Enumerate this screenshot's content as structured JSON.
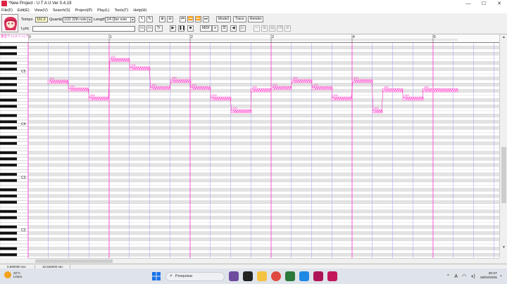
{
  "window": {
    "title": "*New Project - U T A U Ver 0.4.19",
    "controls": [
      "—",
      "☐",
      "✕"
    ]
  },
  "menu": [
    "File(F)",
    "Edit(E)",
    "View(V)",
    "Search(S)",
    "Project(P)",
    "Play(L)",
    "Tools(T)",
    "Help(H)"
  ],
  "toolbar": {
    "tempo_label": "Tempo",
    "tempo_value": "101.0",
    "quantize_label": "Quantize",
    "quantize_value": "1/32 32th note",
    "length_label": "Length",
    "length_value": "1/4 Qter note",
    "lyric_label": "Lyric",
    "lyric_value": "",
    "mode2": "Mode2",
    "trace": "Trace",
    "render": "Render",
    "midi": "MIDI",
    "tr_button": "Tr"
  },
  "track": {
    "name": "重音テト(メイン)\nテキスト音源 ver"
  },
  "ruler": {
    "measures": [
      "0",
      "1",
      "2",
      "3",
      "4",
      "5"
    ]
  },
  "keys": {
    "labels": [
      "C5",
      "C4",
      "C3",
      "C2"
    ]
  },
  "notes": {
    "labels": [
      "100",
      "100",
      "100",
      "100",
      "100",
      "100",
      "100",
      "100",
      "100",
      "100",
      "100",
      "100",
      "100",
      "100",
      "100",
      "100",
      "100",
      "100",
      "100",
      "100"
    ]
  },
  "status": {
    "pos": "0.590000 sec",
    "len": "10.625000 sec"
  },
  "taskbar": {
    "temp": "20°C",
    "weather": "Limpo",
    "search_placeholder": "Pesquisar",
    "time": "20:37",
    "date": "18/04/2025"
  },
  "colors": {
    "note": "#ff66cc",
    "bar_line": "#ff33cc",
    "grid": "#c8c8c8"
  }
}
